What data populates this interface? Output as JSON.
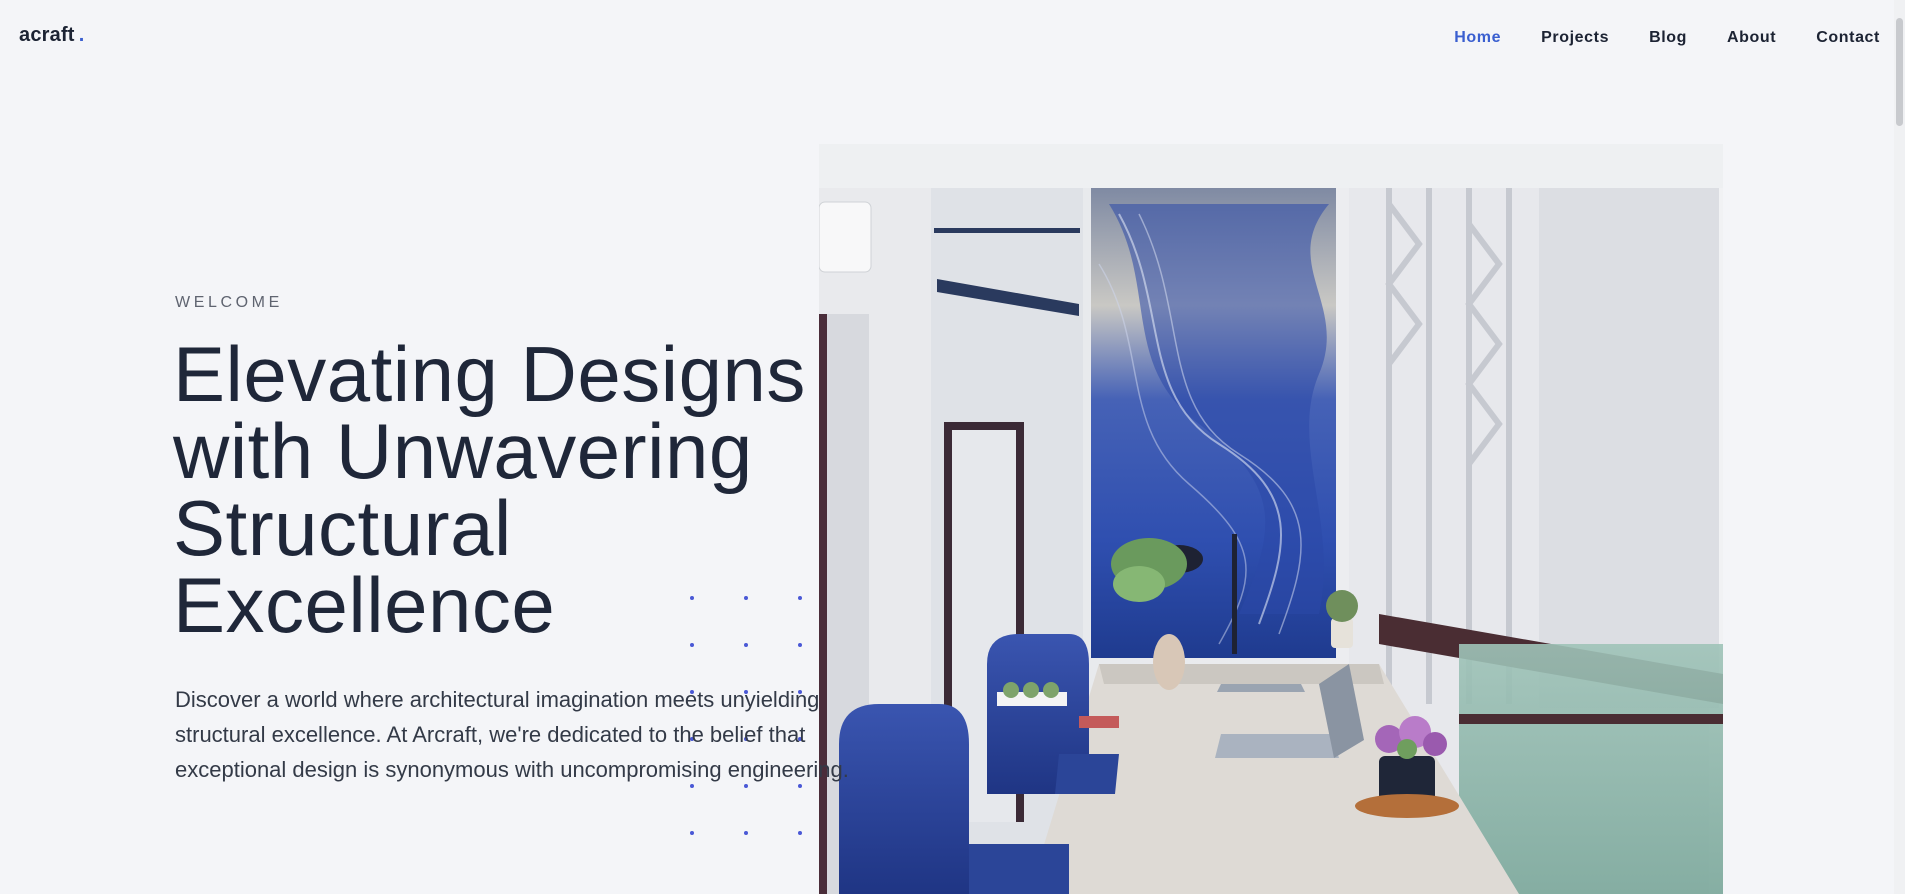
{
  "brand": {
    "name": "acraft",
    "dot": ".",
    "accent": "#3a5fd0"
  },
  "nav": {
    "items": [
      {
        "label": "Home",
        "active": true
      },
      {
        "label": "Projects",
        "active": false
      },
      {
        "label": "Blog",
        "active": false
      },
      {
        "label": "About",
        "active": false
      },
      {
        "label": "Contact",
        "active": false
      }
    ]
  },
  "hero": {
    "eyebrow": "WELCOME",
    "headline_lines": [
      "Elevating Designs",
      "with Unwavering",
      "Structural",
      "Excellence"
    ],
    "lead": "Discover a world where architectural imagination meets unyielding structural excellence. At Arcraft, we're dedicated to the belief that exceptional design is synonymous with uncompromising engineering.",
    "image": "interior-office-photo"
  },
  "colors": {
    "background": "#f4f5f8",
    "text": "#1f2739",
    "dots": "#4a58d6"
  }
}
